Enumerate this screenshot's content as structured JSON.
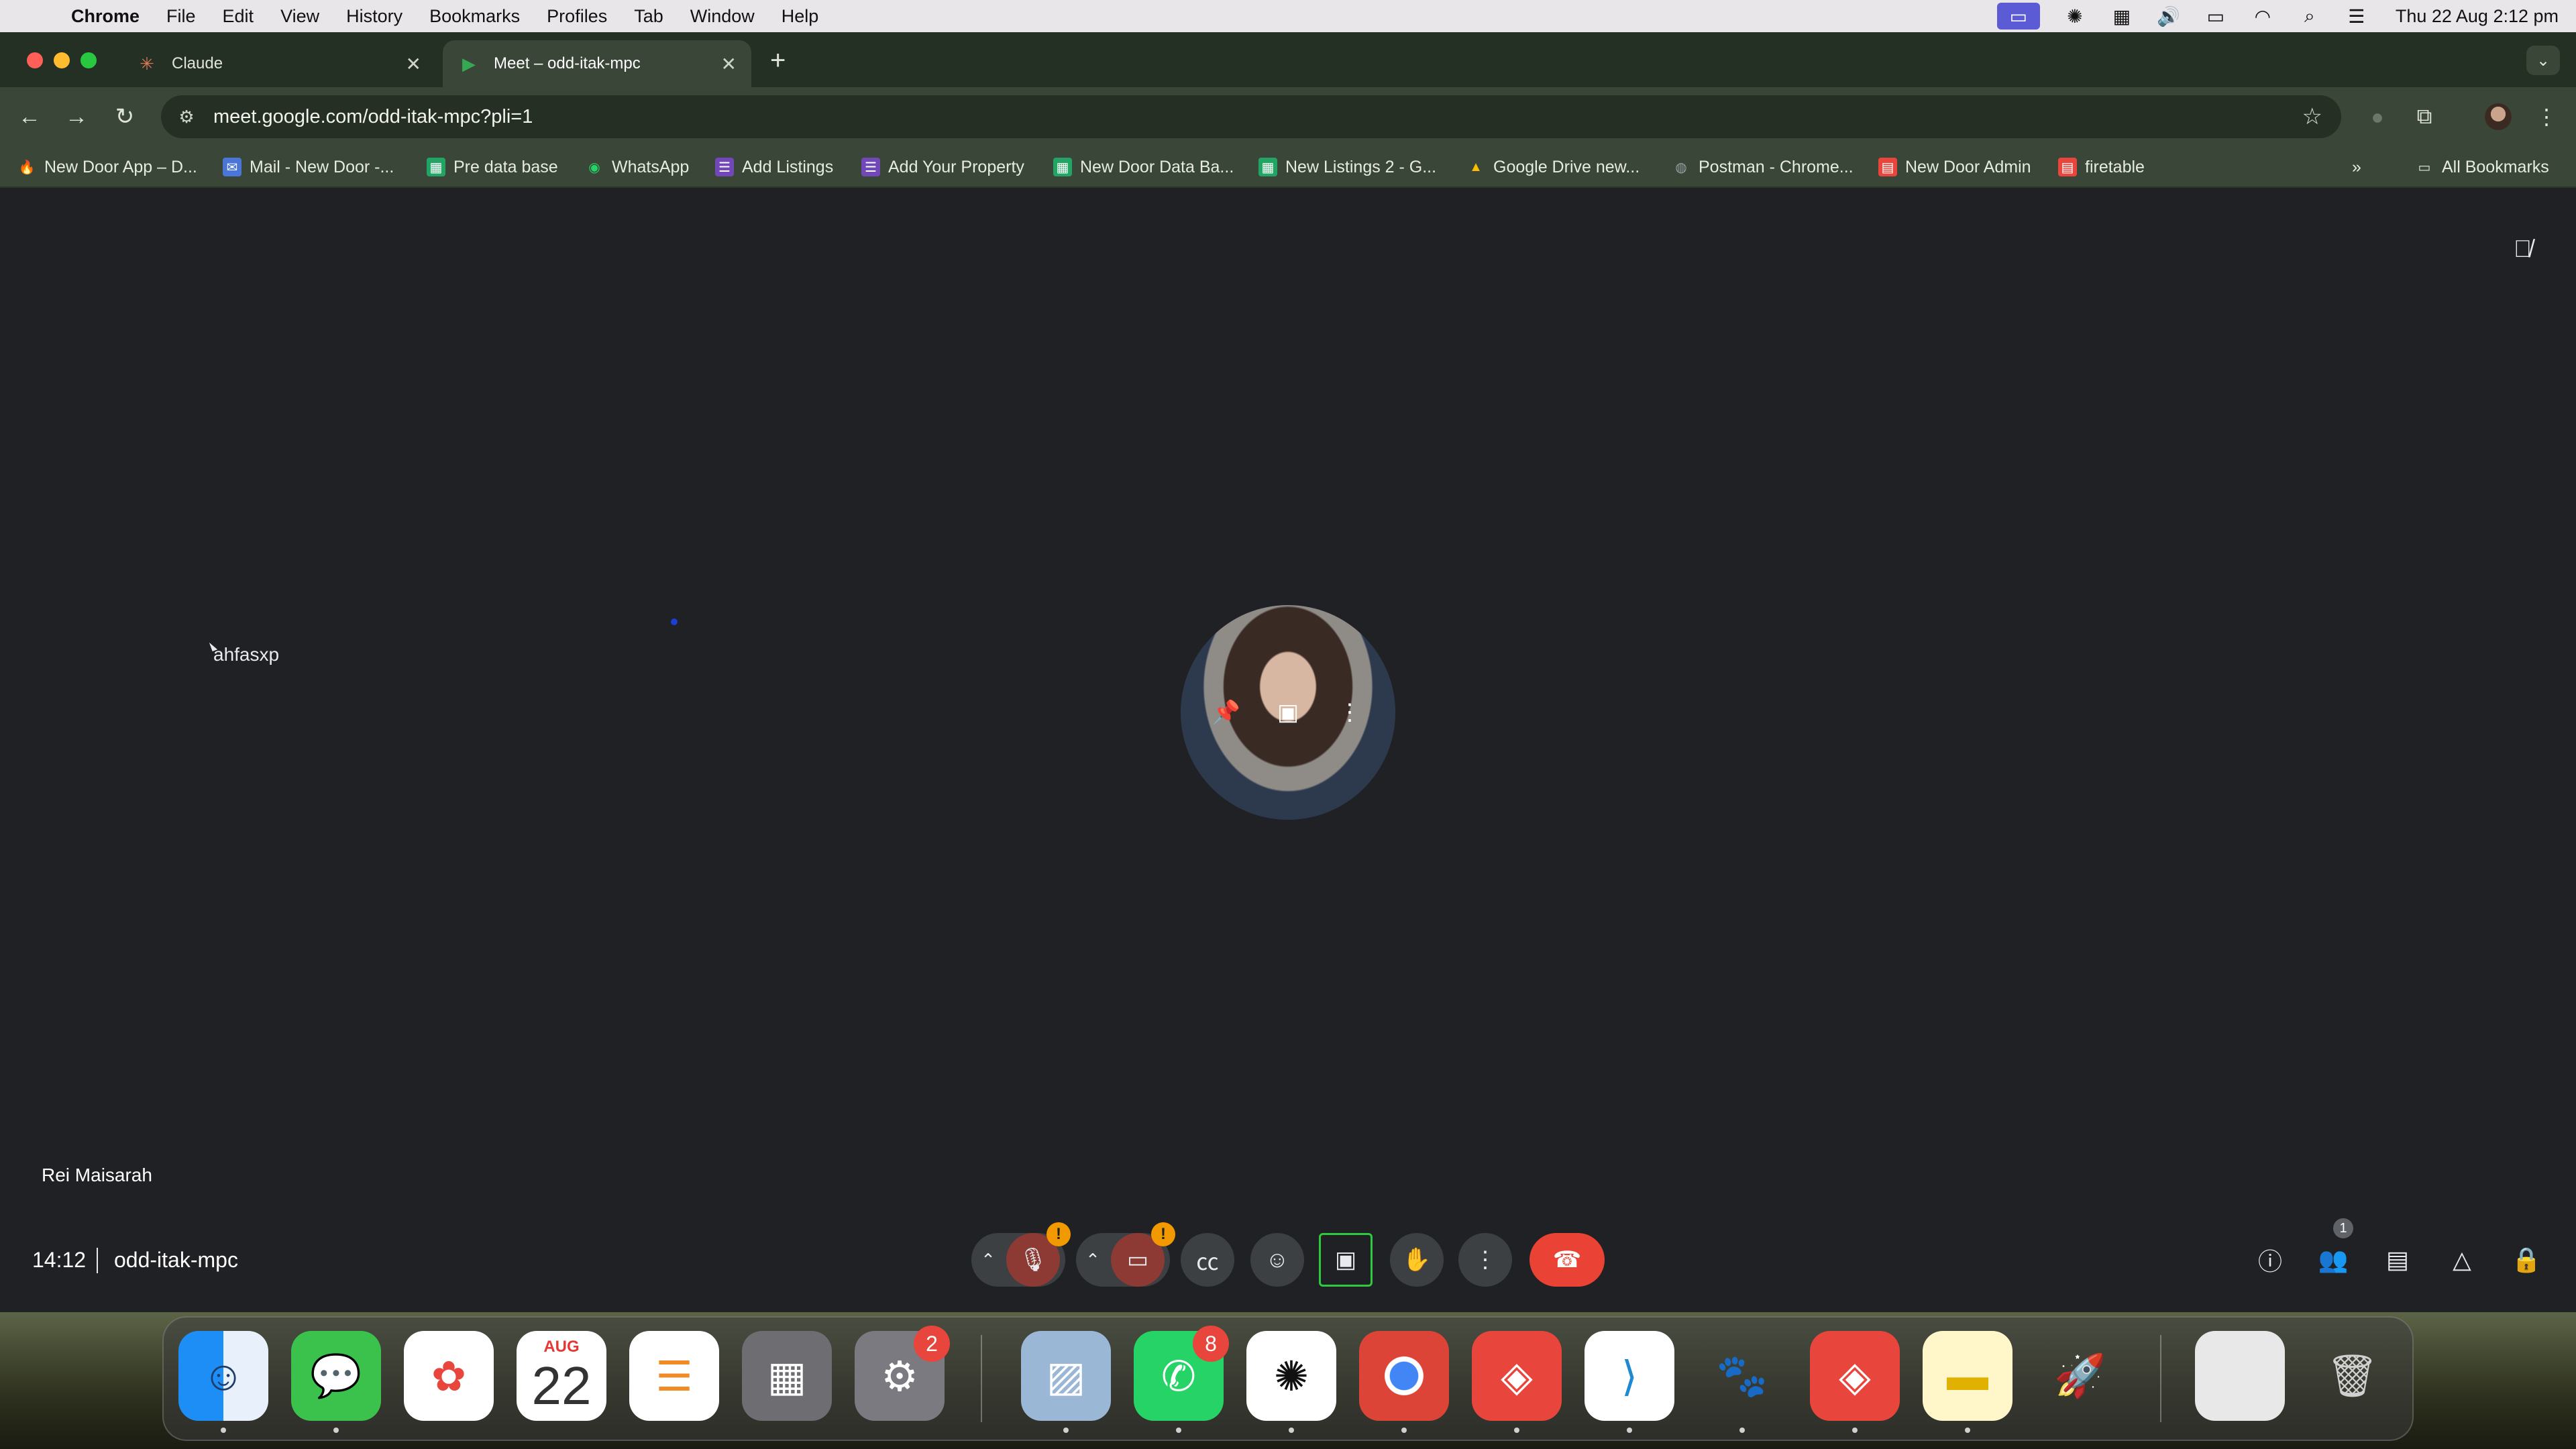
{
  "menubar": {
    "app": "Chrome",
    "items": [
      "File",
      "Edit",
      "View",
      "History",
      "Bookmarks",
      "Profiles",
      "Tab",
      "Window",
      "Help"
    ],
    "clock": "Thu 22 Aug  2:12 pm"
  },
  "tabs": [
    {
      "title": "Claude",
      "icon": "claude-icon",
      "active": false
    },
    {
      "title": "Meet – odd-itak-mpc",
      "icon": "meet-icon",
      "active": true
    }
  ],
  "toolbar": {
    "url": "meet.google.com/odd-itak-mpc?pli=1"
  },
  "bookmarks": [
    {
      "label": "New Door App – D...",
      "icon": "flame-icon",
      "color": "#f5a623"
    },
    {
      "label": "Mail - New Door -...",
      "icon": "mail-icon",
      "color": "#4a76d8"
    },
    {
      "label": "Pre data base",
      "icon": "sheets-icon",
      "color": "#21a464"
    },
    {
      "label": "WhatsApp",
      "icon": "whatsapp-icon",
      "color": "#25d366"
    },
    {
      "label": "Add Listings",
      "icon": "forms-icon",
      "color": "#7248b9"
    },
    {
      "label": "Add Your Property",
      "icon": "forms-icon",
      "color": "#7248b9"
    },
    {
      "label": "New Door Data Ba...",
      "icon": "sheets-icon",
      "color": "#21a464"
    },
    {
      "label": "New Listings 2 - G...",
      "icon": "sheets-icon",
      "color": "#21a464"
    },
    {
      "label": "Google Drive new...",
      "icon": "drive-icon",
      "color": "#fbbc04"
    },
    {
      "label": "Postman - Chrome...",
      "icon": "globe-icon",
      "color": "#9aa0a6"
    },
    {
      "label": "New Door Admin",
      "icon": "admin-icon",
      "color": "#e8453c"
    },
    {
      "label": "firetable",
      "icon": "firetable-icon",
      "color": "#e8453c"
    }
  ],
  "all_bookmarks": "All Bookmarks",
  "meet": {
    "cursor_label": "ahfasxp",
    "participant_name": "Rei Maisarah",
    "time": "14:12",
    "meeting_code": "odd-itak-mpc",
    "people_count": "1"
  },
  "dock": {
    "calendar_month": "AUG",
    "calendar_day": "22",
    "settings_badge": "2",
    "whatsapp_badge": "8"
  }
}
